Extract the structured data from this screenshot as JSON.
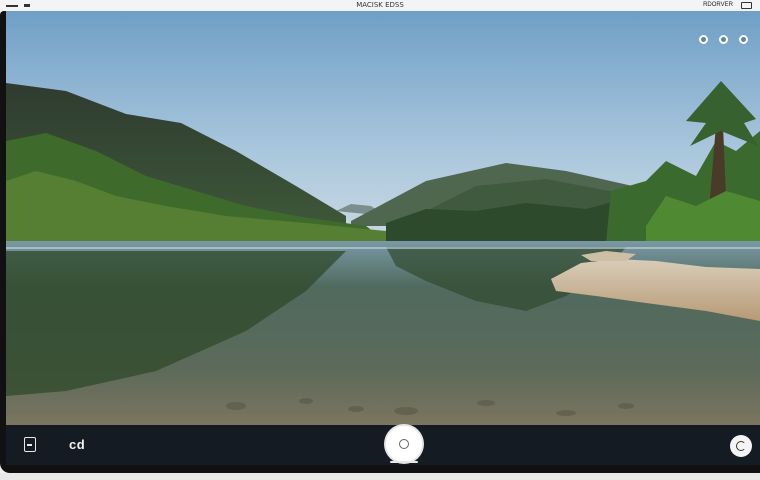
{
  "status_bar": {
    "title": "MACISK EDSS",
    "right_text": "RDORVER"
  },
  "controls": {
    "mode_label": "cd"
  },
  "icons": {
    "status_left": "menu-mark-icon",
    "status_battery": "battery-icon",
    "gallery": "gallery-icon",
    "shutter": "shutter-icon",
    "camera_switch": "camera-switch-icon",
    "overlay": [
      "flash-icon",
      "timer-icon",
      "settings-icon"
    ]
  },
  "colors": {
    "control_bar": "#141b22",
    "shutter": "#ffffff",
    "sky_top": "#6f9fc6",
    "water": "#4a6257"
  }
}
